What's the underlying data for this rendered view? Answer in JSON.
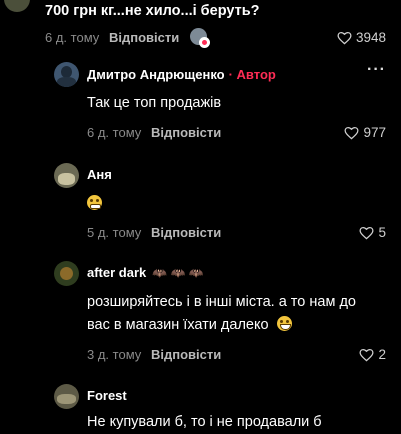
{
  "parent": {
    "text": "700 грн кг...не хило...і беруть?",
    "time": "6 д. тому",
    "reply_label": "Відповісти",
    "likes": "3948"
  },
  "replies": [
    {
      "author": "Дмитро Андрющенко",
      "badge": "· Автор",
      "text": "Так це топ продажів",
      "time": "6 д. тому",
      "reply_label": "Відповісти",
      "likes": "977"
    },
    {
      "author": "Аня",
      "text": "",
      "time": "5 д. тому",
      "reply_label": "Відповісти",
      "likes": "5"
    },
    {
      "author": "after dark",
      "author_suffix": "🦇 🦇 🦇",
      "text_line1": "розширяйтесь і в інші міста. а то нам до",
      "text_line2": "вас в магазин їхати далеко",
      "time": "3 д. тому",
      "reply_label": "Відповісти",
      "likes": "2"
    },
    {
      "author": "Forest",
      "text": "Не купували б, то і не продавали б"
    }
  ],
  "more_label": "···",
  "icons": {
    "heart": "heart-outline-icon",
    "emoji_grimace": "grimacing-face-icon",
    "emoji_smile": "grinning-face-icon"
  }
}
